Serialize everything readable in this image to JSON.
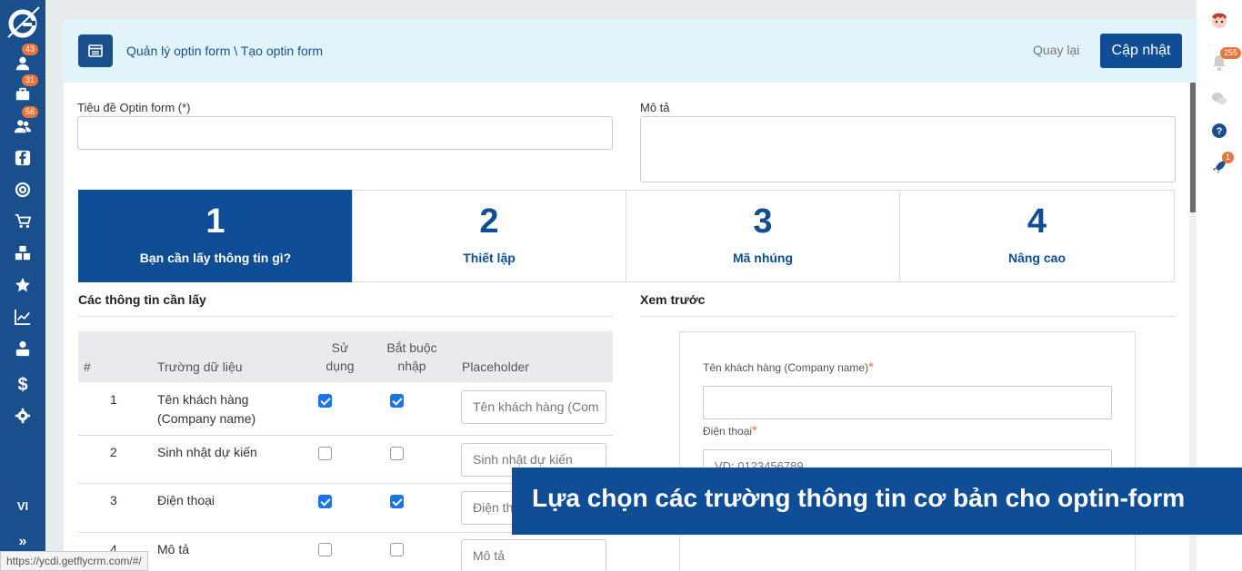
{
  "sidebar": {
    "items": [
      {
        "icon": "user-icon",
        "badge": "43"
      },
      {
        "icon": "briefcase-icon",
        "badge": "31"
      },
      {
        "icon": "users-icon",
        "badge": "56"
      },
      {
        "icon": "facebook-icon",
        "badge": ""
      },
      {
        "icon": "target-icon",
        "badge": ""
      },
      {
        "icon": "cart-icon",
        "badge": ""
      },
      {
        "icon": "cubes-icon",
        "badge": ""
      },
      {
        "icon": "star-icon",
        "badge": ""
      },
      {
        "icon": "chart-icon",
        "badge": ""
      },
      {
        "icon": "sitemap-icon",
        "badge": ""
      },
      {
        "icon": "dollar-icon",
        "badge": ""
      },
      {
        "icon": "gear-icon",
        "badge": ""
      }
    ],
    "language": "VI",
    "expand_label": "»"
  },
  "topbar": {
    "breadcrumb": "Quản lý optin form \\ Tạo optin form",
    "back_label": "Quay lại",
    "update_label": "Cập nhật"
  },
  "form": {
    "title_label": "Tiêu đề Optin form (*)",
    "desc_label": "Mô tả"
  },
  "steps": [
    {
      "num": "1",
      "name": "Bạn cần lấy thông tin gì?",
      "active": true
    },
    {
      "num": "2",
      "name": "Thiết lập",
      "active": false
    },
    {
      "num": "3",
      "name": "Mã nhúng",
      "active": false
    },
    {
      "num": "4",
      "name": "Nâng cao",
      "active": false
    }
  ],
  "fields_section": {
    "title": "Các thông tin cần lấy",
    "headers": {
      "index": "#",
      "field": "Trường dữ liệu",
      "use_1": "Sử",
      "use_2": "dụng",
      "required_1": "Bắt buộc",
      "required_2": "nhập",
      "placeholder": "Placeholder"
    },
    "rows": [
      {
        "index": "1",
        "field_1": "Tên khách hàng",
        "field_2": "(Company name)",
        "use": true,
        "required": true,
        "placeholder": "Tên khách hàng (Com"
      },
      {
        "index": "2",
        "field_1": "Sinh nhật dự kiến",
        "field_2": "",
        "use": false,
        "required": false,
        "placeholder": "Sinh nhật dự kiến"
      },
      {
        "index": "3",
        "field_1": "Điện thoại",
        "field_2": "",
        "use": true,
        "required": true,
        "placeholder": "Điện thoại"
      },
      {
        "index": "4",
        "field_1": "Mô tả",
        "field_2": "",
        "use": false,
        "required": false,
        "placeholder": "Mô tả"
      }
    ]
  },
  "preview": {
    "title": "Xem trước",
    "name_label": "Tên khách hàng (Company name)",
    "phone_label": "Điện thoại",
    "phone_placeholder": "VD: 0123456789",
    "required_mark": "*"
  },
  "right_bar": {
    "notifications_badge": "255",
    "rocket_badge": "1"
  },
  "banner": {
    "text": "Lựa chọn các trường thông tin cơ bản cho optin-form"
  },
  "status": {
    "url": "https://ycdi.getflycrm.com/#/"
  },
  "colors": {
    "primary": "#0f4d96",
    "sidebar": "#1a4f8e",
    "accent": "#e8743b",
    "checkbox": "#1a73e8"
  }
}
